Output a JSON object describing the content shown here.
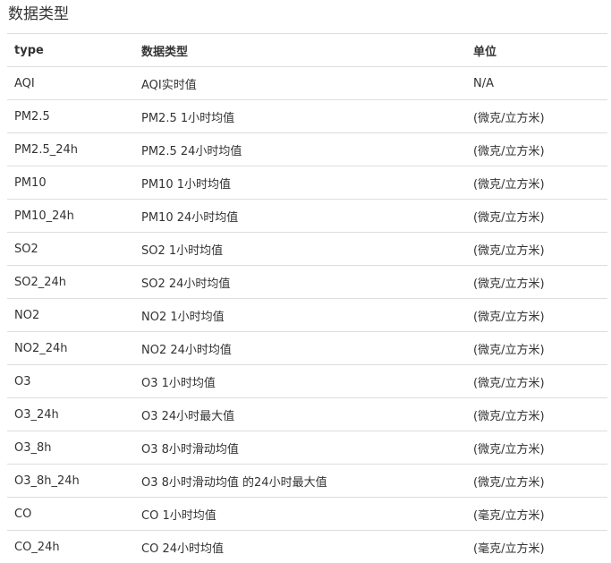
{
  "heading": "数据类型",
  "table": {
    "headers": [
      "type",
      "数据类型",
      "单位"
    ],
    "rows": [
      [
        "AQI",
        "AQI实时值",
        "N/A"
      ],
      [
        "PM2.5",
        "PM2.5 1小时均值",
        "(微克/立方米)"
      ],
      [
        "PM2.5_24h",
        "PM2.5 24小时均值",
        "(微克/立方米)"
      ],
      [
        "PM10",
        "PM10 1小时均值",
        "(微克/立方米)"
      ],
      [
        "PM10_24h",
        "PM10 24小时均值",
        "(微克/立方米)"
      ],
      [
        "SO2",
        "SO2 1小时均值",
        "(微克/立方米)"
      ],
      [
        "SO2_24h",
        "SO2 24小时均值",
        "(微克/立方米)"
      ],
      [
        "NO2",
        "NO2 1小时均值",
        "(微克/立方米)"
      ],
      [
        "NO2_24h",
        "NO2 24小时均值",
        "(微克/立方米)"
      ],
      [
        "O3",
        "O3 1小时均值",
        "(微克/立方米)"
      ],
      [
        "O3_24h",
        "O3 24小时最大值",
        "(微克/立方米)"
      ],
      [
        "O3_8h",
        "O3 8小时滑动均值",
        "(微克/立方米)"
      ],
      [
        "O3_8h_24h",
        "O3 8小时滑动均值 的24小时最大值",
        "(微克/立方米)"
      ],
      [
        "CO",
        "CO 1小时均值",
        "(毫克/立方米)"
      ],
      [
        "CO_24h",
        "CO 24小时均值",
        "(毫克/立方米)"
      ]
    ]
  }
}
